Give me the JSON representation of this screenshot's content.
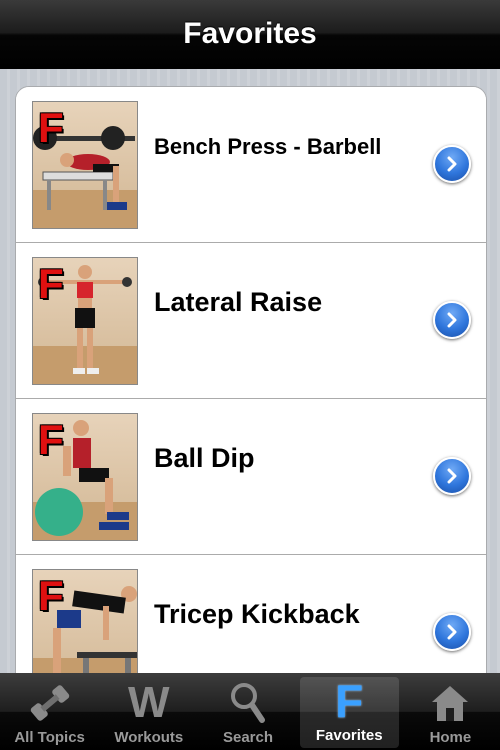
{
  "navbar": {
    "title": "Favorites"
  },
  "favorites": [
    {
      "label": "Bench Press - Barbell",
      "badge": "F"
    },
    {
      "label": "Lateral Raise",
      "badge": "F"
    },
    {
      "label": "Ball Dip",
      "badge": "F"
    },
    {
      "label": "Tricep Kickback",
      "badge": "F"
    }
  ],
  "tabbar": {
    "tabs": [
      {
        "label": "All Topics",
        "icon": "dumbbell-icon",
        "active": false
      },
      {
        "label": "Workouts",
        "icon": "w-letter-icon",
        "glyph": "W",
        "active": false
      },
      {
        "label": "Search",
        "icon": "magnifier-icon",
        "active": false
      },
      {
        "label": "Favorites",
        "icon": "f-letter-icon",
        "glyph": "F",
        "active": true
      },
      {
        "label": "Home",
        "icon": "house-icon",
        "active": false
      }
    ]
  },
  "colors": {
    "accent": "#2f76dc",
    "badge_red": "#e01010"
  }
}
